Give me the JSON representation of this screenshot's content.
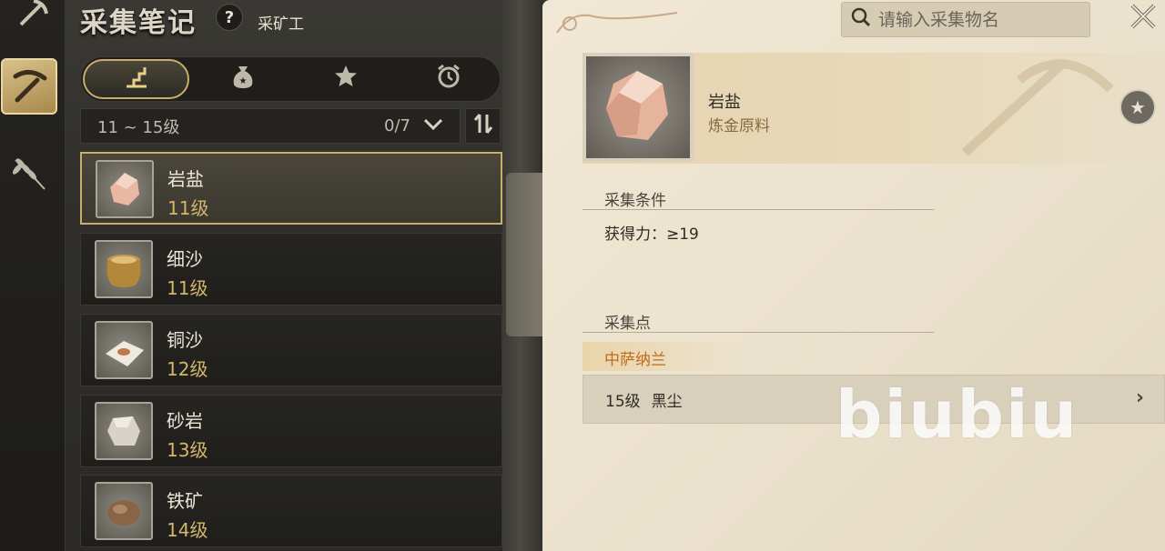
{
  "header": {
    "title": "采集笔记",
    "help_label": "?",
    "profession": "采矿工"
  },
  "rail": {
    "icons": [
      "pickaxe-hammer-icon",
      "pickaxe-icon",
      "wheat-icon"
    ]
  },
  "tabs": [
    {
      "icon": "stairs-icon",
      "glyph": "⬆",
      "active": true
    },
    {
      "icon": "money-bag-icon",
      "glyph": "⛁",
      "active": false
    },
    {
      "icon": "star-icon",
      "glyph": "★",
      "active": false
    },
    {
      "icon": "alarm-clock-icon",
      "glyph": "⏰",
      "active": false
    }
  ],
  "filter": {
    "range": "11 ~ 15级",
    "count": "0/7",
    "dropdown_glyph": "⌄",
    "sort_glyph": "⇅"
  },
  "items": [
    {
      "name": "岩盐",
      "level": "11级",
      "selected": true
    },
    {
      "name": "细沙",
      "level": "11级",
      "selected": false
    },
    {
      "name": "铜沙",
      "level": "12级",
      "selected": false
    },
    {
      "name": "砂岩",
      "level": "13级",
      "selected": false
    },
    {
      "name": "铁矿",
      "level": "14级",
      "selected": false
    }
  ],
  "search": {
    "placeholder": "请输入采集物名"
  },
  "detail": {
    "name": "岩盐",
    "type": "炼金原料",
    "fav_glyph": "★",
    "condition_title": "采集条件",
    "condition_text": "获得力：≥19",
    "spot_title": "采集点",
    "region": "中萨纳兰",
    "spot_level": "15级",
    "spot_name": "黑尘",
    "spot_arrow": "›"
  },
  "watermark": "biubiu",
  "colors": {
    "gold_accent": "#c9ad6a",
    "level_text": "#d4b66a",
    "region_text": "#c06a1c",
    "page_bg": "#f0e8d5"
  }
}
